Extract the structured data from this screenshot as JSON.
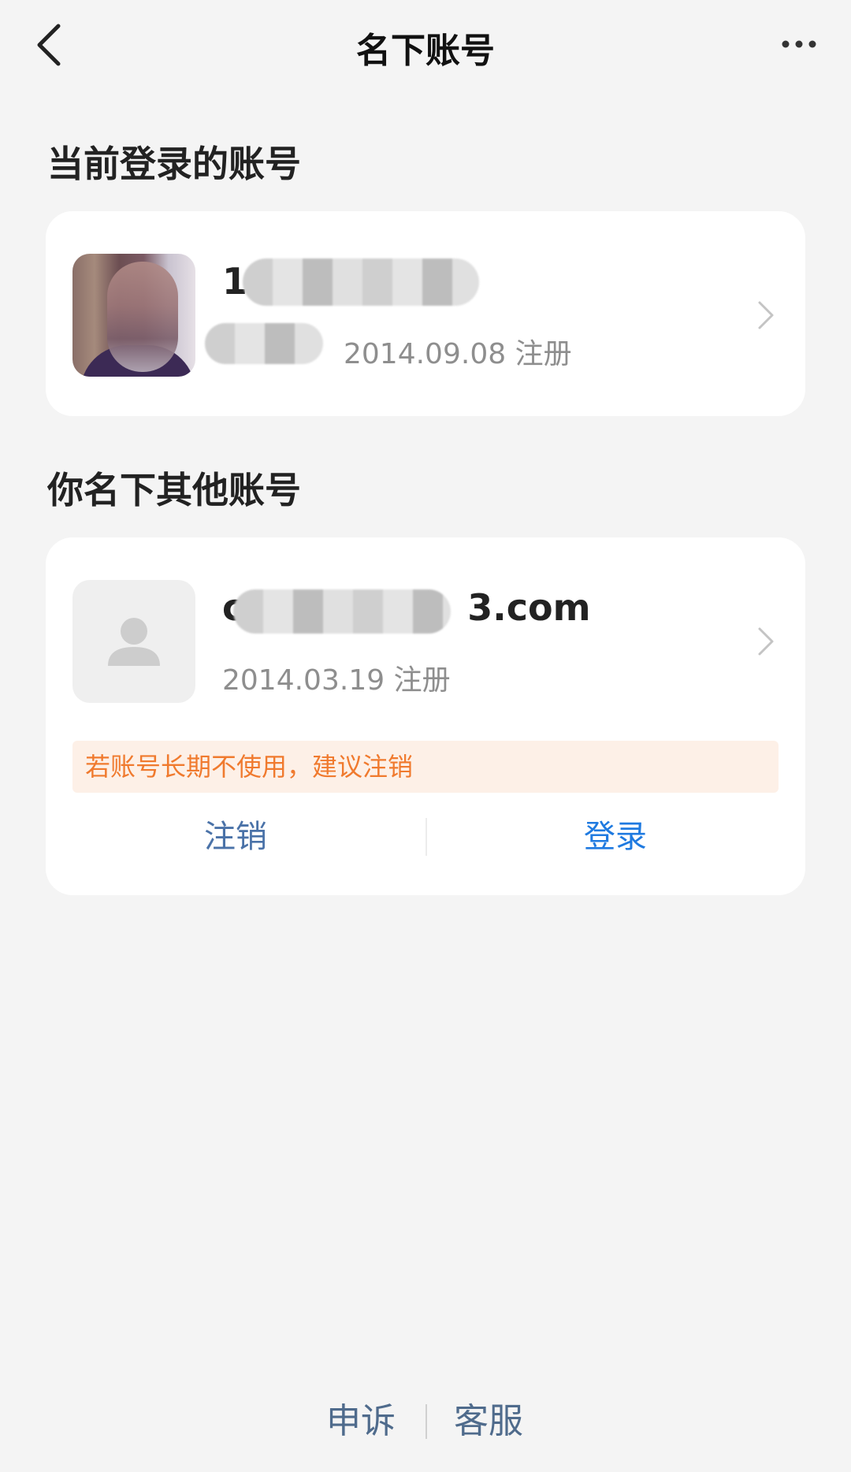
{
  "header": {
    "title": "名下账号",
    "back_icon": "back-arrow-icon",
    "more_icon": "more-dots-icon"
  },
  "current_section": {
    "title": "当前登录的账号",
    "account": {
      "name_visible_prefix": "1",
      "registered": "2014.09.08 注册",
      "avatar": "user-photo"
    }
  },
  "other_section": {
    "title": "你名下其他账号",
    "account": {
      "name_visible_prefix": "c",
      "name_visible_suffix": "3.com",
      "registered": "2014.03.19 注册",
      "avatar": "default-user-icon",
      "warning": "若账号长期不使用，建议注销",
      "cancel_label": "注销",
      "login_label": "登录"
    }
  },
  "footer": {
    "appeal_label": "申诉",
    "service_label": "客服"
  },
  "colors": {
    "background": "#f4f4f4",
    "card": "#ffffff",
    "warning_text": "#f07a2e",
    "warning_bg": "#fdf0e7",
    "login_blue": "#1f7ae0",
    "cancel_blue": "#4a72a8"
  }
}
